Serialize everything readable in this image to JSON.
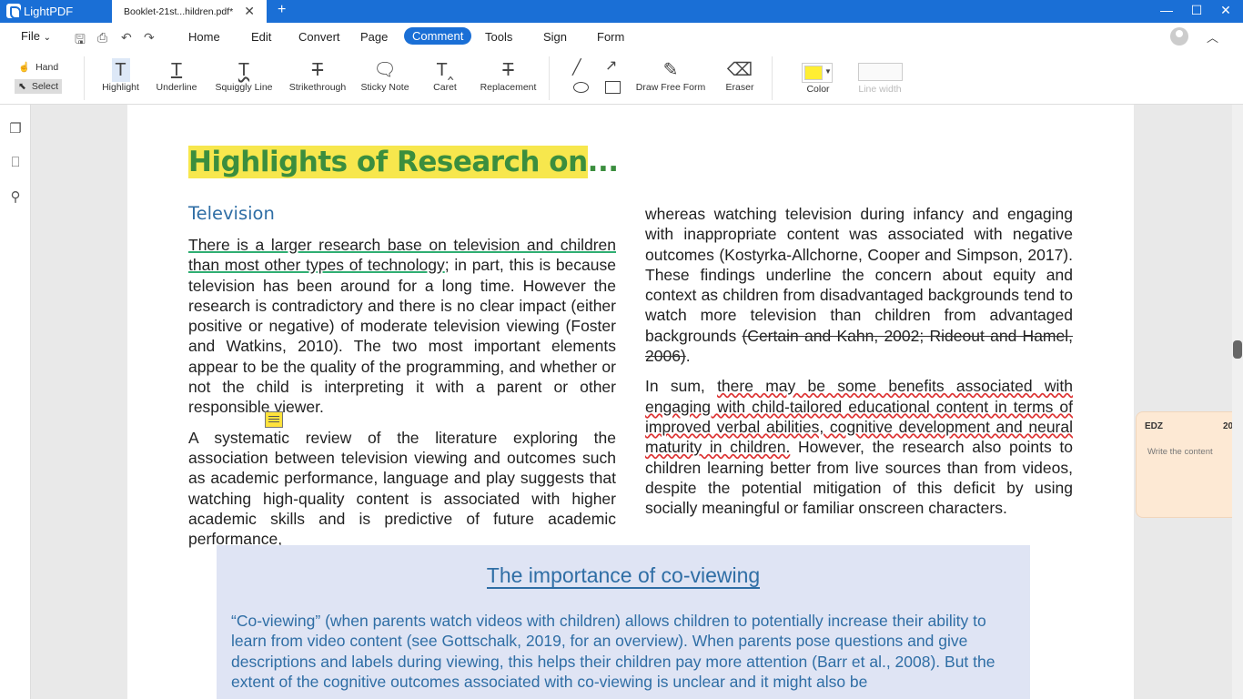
{
  "titlebar": {
    "app_name": "LightPDF",
    "doc_tab": "Booklet-21st...hildren.pdf*",
    "close": "✕",
    "new_tab": "+",
    "minimize": "—",
    "maximize": "☐",
    "close_window": "✕"
  },
  "menubar": {
    "file": "File",
    "items": [
      "Home",
      "Edit",
      "Convert",
      "Page",
      "Comment",
      "Tools",
      "Sign",
      "Form"
    ],
    "active": "Comment"
  },
  "toolbar": {
    "hand": "Hand",
    "select": "Select",
    "tools": [
      "Highlight",
      "Underline",
      "Squiggly Line",
      "Strikethrough",
      "Sticky Note",
      "Caret",
      "Replacement"
    ],
    "draw_free_form": "Draw Free Form",
    "eraser": "Eraser",
    "color": "Color",
    "line_width": "Line width",
    "color_value": "#ffee33"
  },
  "document": {
    "title_highlighted": "Highlights of Research on",
    "title_rest": "...",
    "section": "Television",
    "left_p1_underlined": "There is a larger research base on television and children than most other types of technology",
    "left_p1_rest": "; in part, this is because television has been around for a long time. However the research is contradictory and there is no clear impact (either positive or negative) of moderate television viewing (Foster and Watkins, 2010). The two most important elements appear to be the quality of the programming, and whether or not the child is interpreting it with a parent or other responsible viewer.",
    "left_p2": "A systematic review of the literature exploring the association between television viewing and outcomes such as academic performance, language and play suggests that watching high-quality content is associated with higher academic skills and is predictive of future academic performance,",
    "right_p1": "whereas watching television during infancy and engaging with inappropriate content was associated with negative outcomes (Kostyrka-Allchorne, Cooper and Simpson, 2017). These findings underline the concern about equity and context as children from disadvantaged backgrounds tend to watch more television than children from advantaged backgrounds ",
    "right_p1_strike": "(Certain and Kahn, 2002; Rideout and Hamel, 2006)",
    "right_p1_end": ".",
    "right_p2_start": "In sum, ",
    "right_p2_wavy": "there may be some benefits associated with engaging with child-tailored educational content in terms of improved verbal abilities, cognitive development and neural maturity in children.",
    "right_p2_rest": " However, the research also points to children learning better from live sources than from videos, despite the potential mitigation of this deficit by using socially meaningful or familiar onscreen characters.",
    "box_title": "The importance of co-viewing",
    "box_text": "“Co-viewing” (when parents watch videos with children) allows children to potentially increase their ability to learn from video content (see Gottschalk, 2019, for an overview). When parents pose questions and give descriptions and labels during viewing, this helps their children pay more attention (Barr et al., 2008). But the extent of the cognitive outcomes associated with co-viewing is unclear and it might also be"
  },
  "comment": {
    "author": "EDZ",
    "date": "20",
    "placeholder": "Write the content"
  }
}
